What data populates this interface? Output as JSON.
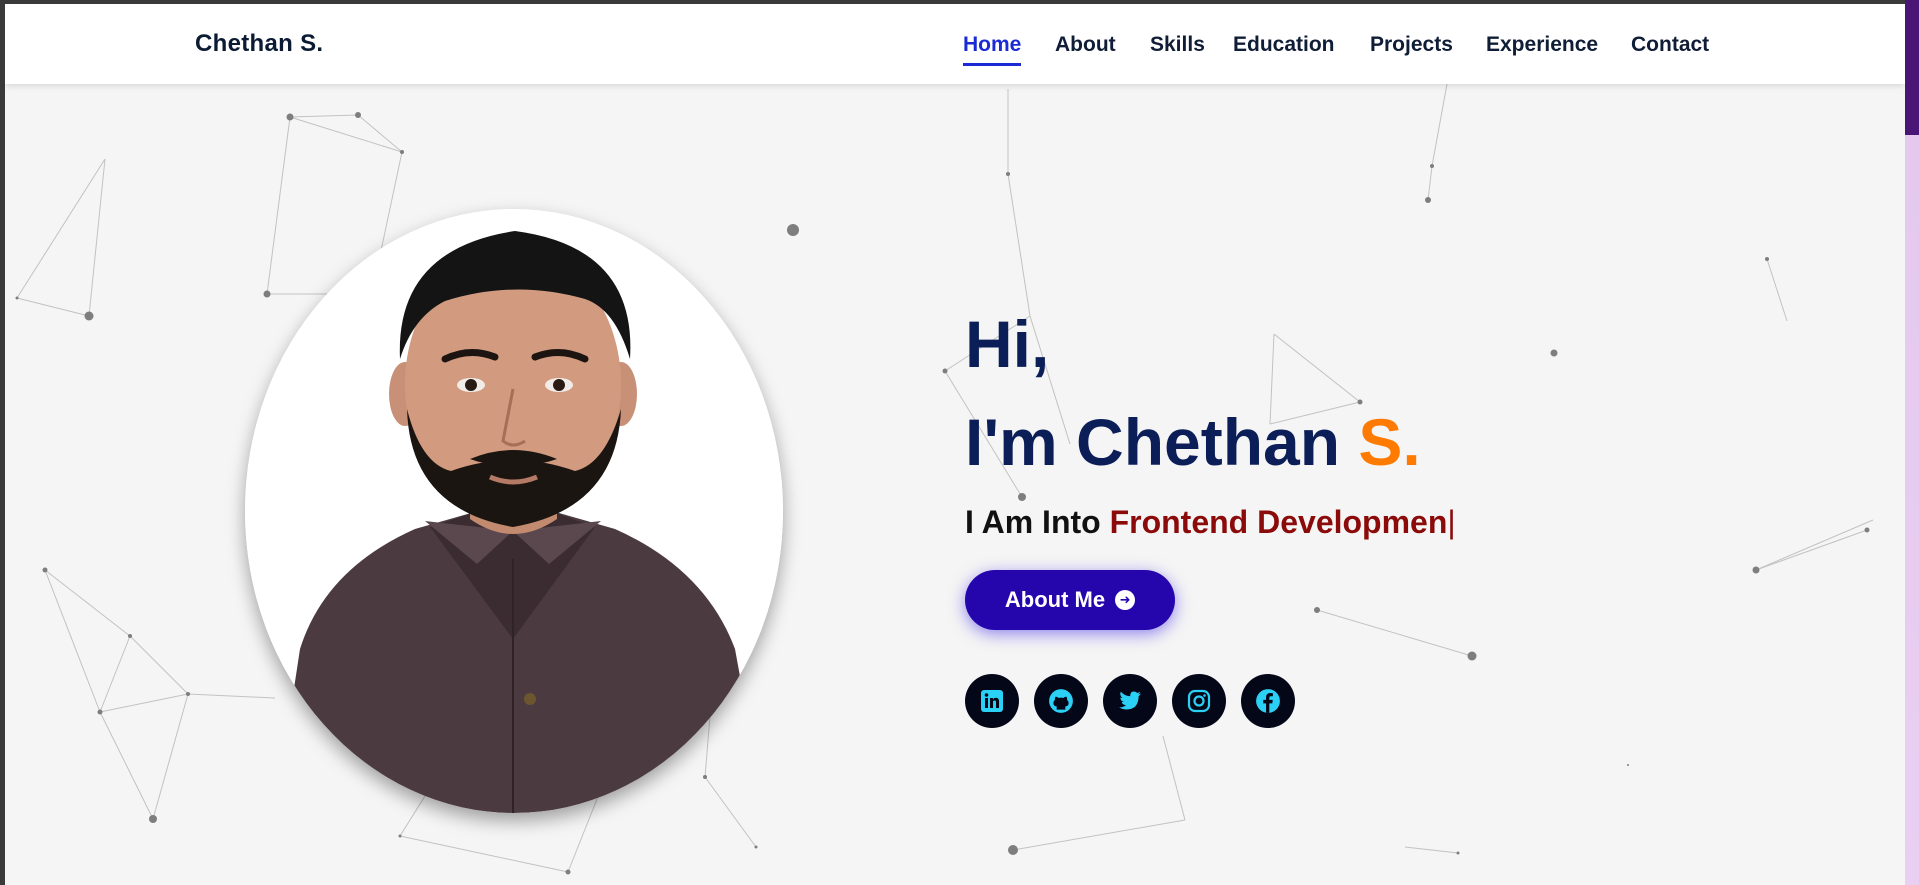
{
  "navbar": {
    "brand": "Chethan S.",
    "links": [
      {
        "label": "Home",
        "active": true
      },
      {
        "label": "About"
      },
      {
        "label": "Skills"
      },
      {
        "label": "Education"
      },
      {
        "label": "Projects"
      },
      {
        "label": "Experience"
      },
      {
        "label": "Contact"
      }
    ]
  },
  "hero": {
    "greeting": "Hi,",
    "intro": "I'm Chethan ",
    "name_accent": "S.",
    "tagline_prefix": "I Am Into ",
    "tagline_typed": "Frontend Developmen",
    "cursor": "|",
    "button_label": "About Me",
    "button_icon": "arrow-down-circle-icon"
  },
  "socials": [
    {
      "icon": "linkedin-icon"
    },
    {
      "icon": "github-icon"
    },
    {
      "icon": "twitter-icon"
    },
    {
      "icon": "instagram-icon"
    },
    {
      "icon": "facebook-icon"
    }
  ],
  "colors": {
    "brand_dark": "#0b1e58",
    "accent_orange": "#ff7a00",
    "typed_text": "#8b0a0a",
    "nav_active": "#1a2bd6",
    "button_bg": "#2506ad",
    "social_bg": "#040718",
    "social_icon": "#2bd0f5",
    "page_bg": "#f5f5f5"
  }
}
